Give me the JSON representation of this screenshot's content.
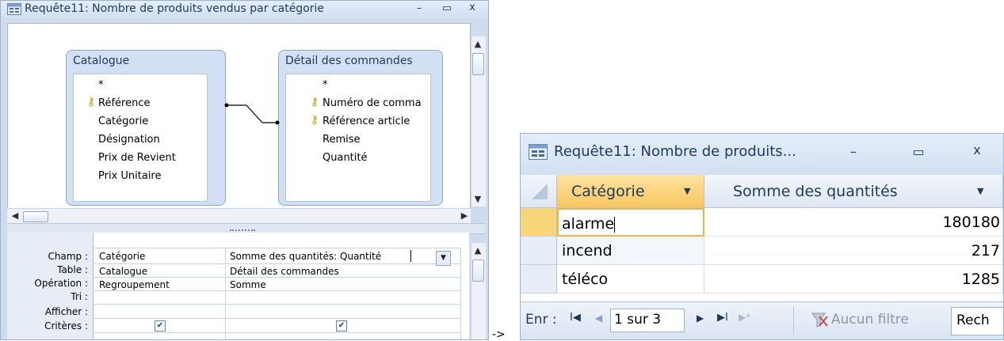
{
  "design_window": {
    "title": "Requête11: Nombre de produits vendus par catégorie",
    "controls": {
      "minimize": "–",
      "restore": "▭",
      "close": "x"
    },
    "tables": [
      {
        "name": "Catalogue",
        "fields": [
          {
            "label": "*",
            "key": false
          },
          {
            "label": "Référence",
            "key": true
          },
          {
            "label": "Catégorie",
            "key": false
          },
          {
            "label": "Désignation",
            "key": false
          },
          {
            "label": "Prix de Revient",
            "key": false
          },
          {
            "label": "Prix Unitaire",
            "key": false
          }
        ]
      },
      {
        "name": "Détail des commandes",
        "fields": [
          {
            "label": "*",
            "key": false
          },
          {
            "label": "Numéro de comma",
            "key": true
          },
          {
            "label": "Référence article",
            "key": true
          },
          {
            "label": "Remise",
            "key": false
          },
          {
            "label": "Quantité",
            "key": false
          }
        ]
      }
    ],
    "grid": {
      "row_labels": [
        "Champ :",
        "Table :",
        "Opération :",
        "Tri :",
        "Afficher :",
        "Critères :"
      ],
      "columns": [
        {
          "champ": "Catégorie",
          "table": "Catalogue",
          "operation": "Regroupement",
          "tri": "",
          "afficher": true
        },
        {
          "champ": "Somme des quantités: Quantité",
          "table": "Détail des commandes",
          "operation": "Somme",
          "tri": "",
          "afficher": true
        }
      ]
    }
  },
  "arrow": "->",
  "datasheet_window": {
    "title": "Requête11: Nombre de produits...",
    "controls": {
      "minimize": "–",
      "restore": "▭",
      "close": "x"
    },
    "columns": [
      "Catégorie",
      "Somme des quantités"
    ],
    "rows": [
      {
        "categorie": "alarme",
        "somme": "180180"
      },
      {
        "categorie": "incend",
        "somme": "217"
      },
      {
        "categorie": "téléco",
        "somme": "1285"
      }
    ],
    "navigation": {
      "label": "Enr :",
      "first": "I◀",
      "prev": "◀",
      "record": "1 sur 3",
      "next": "▶",
      "last": "▶I",
      "new": "▶*",
      "filter": "Aucun filtre",
      "search": "Rech"
    }
  }
}
